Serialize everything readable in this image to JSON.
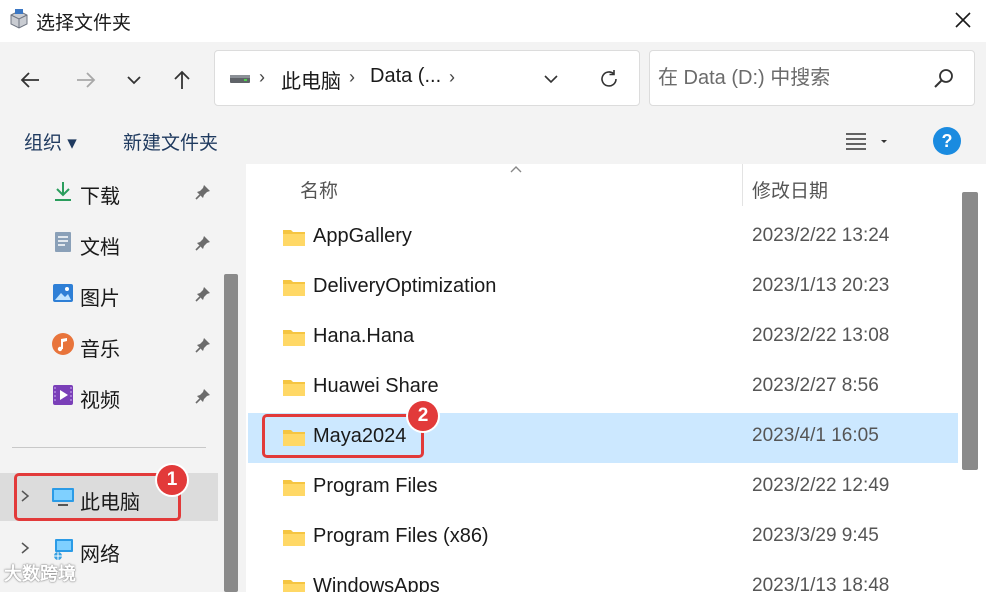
{
  "window": {
    "title": "选择文件夹",
    "close_icon": "close-icon"
  },
  "navigation": {
    "back_icon": "arrow-left-icon",
    "forward_icon": "arrow-right-icon",
    "recent_icon": "chevron-down-icon",
    "up_icon": "arrow-up-icon"
  },
  "address": {
    "drive_icon": "drive-icon",
    "crumbs": [
      "此电脑",
      "Data (..."
    ],
    "dropdown_icon": "chevron-down-icon",
    "refresh_icon": "refresh-icon"
  },
  "search": {
    "placeholder": "在 Data (D:) 中搜索",
    "value": ""
  },
  "commands": {
    "organize": "组织 ▾",
    "new_folder": "新建文件夹",
    "view_icon": "list-view-icon",
    "help_label": "?"
  },
  "sidebar": {
    "items": [
      {
        "label": "下载",
        "icon": "download-icon",
        "pinned": true
      },
      {
        "label": "文档",
        "icon": "document-icon",
        "pinned": true
      },
      {
        "label": "图片",
        "icon": "picture-icon",
        "pinned": true
      },
      {
        "label": "音乐",
        "icon": "music-icon",
        "pinned": true
      },
      {
        "label": "视频",
        "icon": "video-icon",
        "pinned": true
      }
    ],
    "tree": [
      {
        "label": "此电脑",
        "icon": "computer-icon",
        "selected": true
      },
      {
        "label": "网络",
        "icon": "network-icon",
        "selected": false
      }
    ]
  },
  "file_list": {
    "columns": {
      "name": "名称",
      "modified": "修改日期"
    },
    "rows": [
      {
        "name": "AppGallery",
        "date": "2023/2/22 13:24",
        "selected": false
      },
      {
        "name": "DeliveryOptimization",
        "date": "2023/1/13 20:23",
        "selected": false
      },
      {
        "name": "Hana.Hana",
        "date": "2023/2/22 13:08",
        "selected": false
      },
      {
        "name": "Huawei Share",
        "date": "2023/2/27 8:56",
        "selected": false
      },
      {
        "name": "Maya2024",
        "date": "2023/4/1 16:05",
        "selected": true
      },
      {
        "name": "Program Files",
        "date": "2023/2/22 12:49",
        "selected": false
      },
      {
        "name": "Program Files (x86)",
        "date": "2023/3/29 9:45",
        "selected": false
      },
      {
        "name": "WindowsApps",
        "date": "2023/1/13 18:48",
        "selected": false
      }
    ]
  },
  "annotations": {
    "step1": "1",
    "step2": "2"
  },
  "watermark": "大数跨境",
  "colors": {
    "accent": "#1a8be0",
    "selection": "#cce8ff",
    "highlight": "#e23a3a",
    "folder": "#f5c542"
  }
}
